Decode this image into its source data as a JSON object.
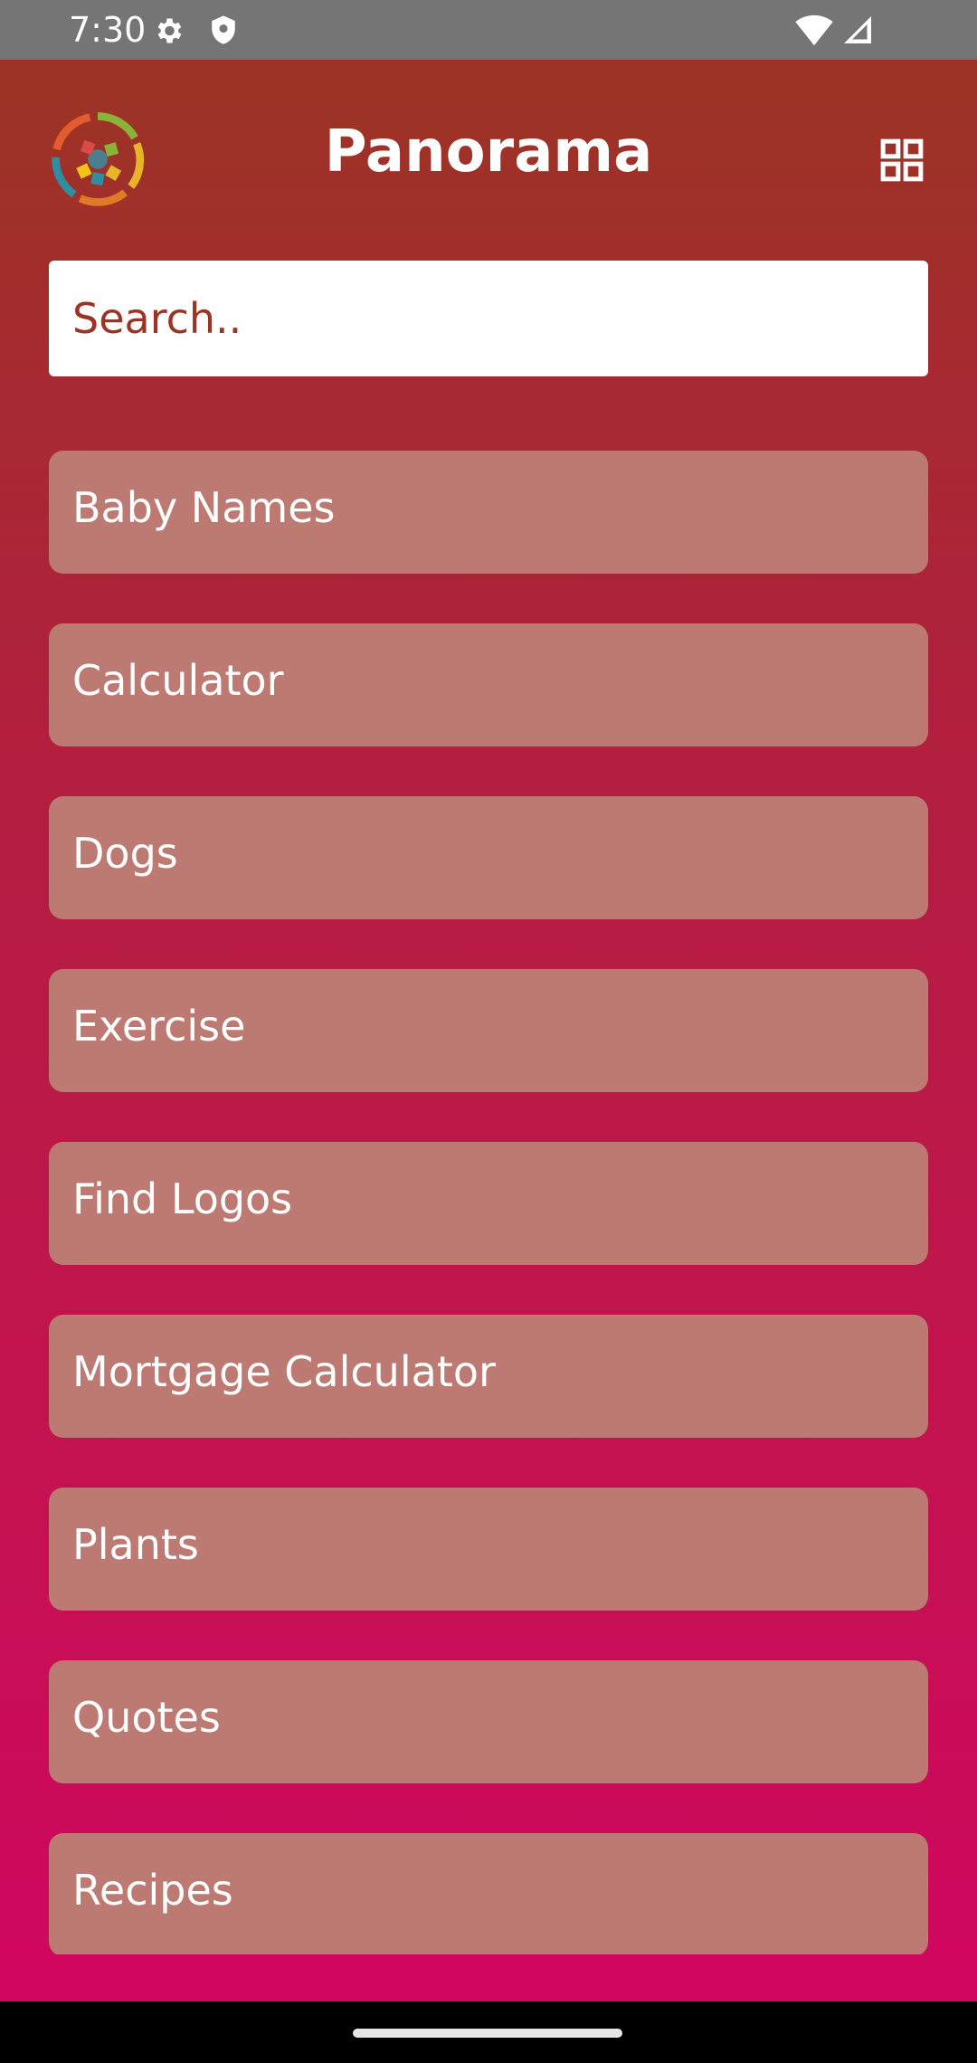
{
  "status_bar": {
    "time": "7:30",
    "icons": [
      "gear-icon",
      "shield-icon",
      "wifi-icon",
      "signal-icon"
    ]
  },
  "header": {
    "title": "Panorama",
    "logo_icon": "panorama-logo-icon",
    "menu_icon": "grid-icon"
  },
  "search": {
    "placeholder": "Search..",
    "value": ""
  },
  "categories": [
    "Baby Names",
    "Calculator",
    "Dogs",
    "Exercise",
    "Find Logos",
    "Mortgage Calculator",
    "Plants",
    "Quotes",
    "Recipes"
  ],
  "colors": {
    "gradient_top": "#9b3424",
    "gradient_bottom": "#d00660",
    "item_background": "#bc7a72",
    "search_text": "#9b3424"
  }
}
